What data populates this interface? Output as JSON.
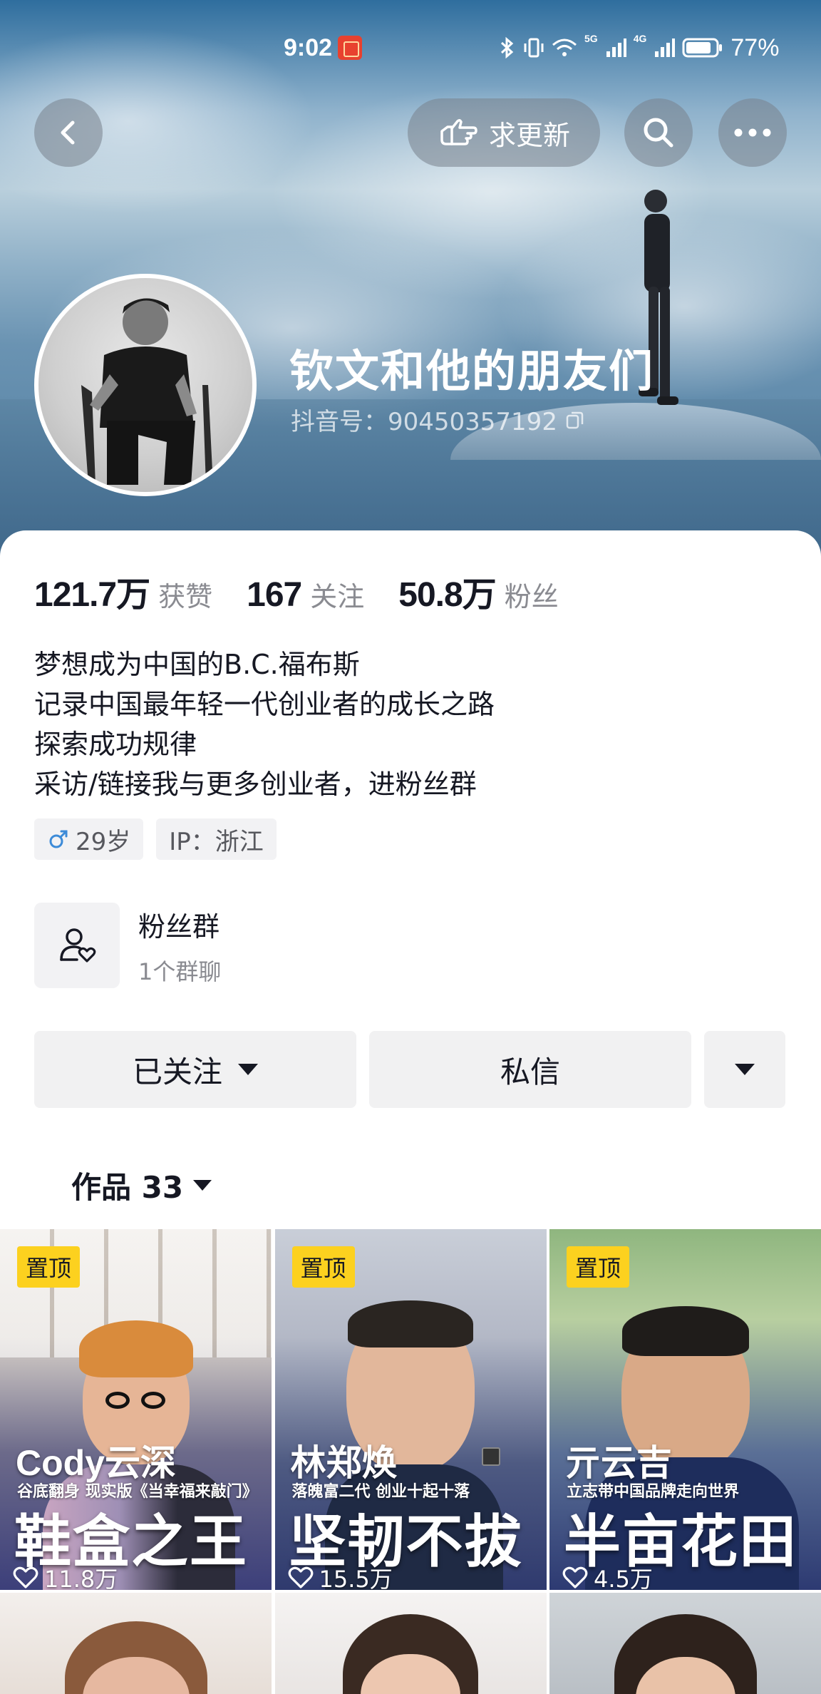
{
  "status_bar": {
    "time": "9:02",
    "battery": "77%",
    "network_labels": [
      "5G",
      "4G"
    ]
  },
  "header": {
    "request_update_label": "求更新",
    "nickname": "钦文和他的朋友们",
    "douyin_id": "抖音号：90450357192"
  },
  "stats": [
    {
      "value": "121.7万",
      "label": "获赞"
    },
    {
      "value": "167",
      "label": "关注"
    },
    {
      "value": "50.8万",
      "label": "粉丝"
    }
  ],
  "bio_lines": [
    "梦想成为中国的B.C.福布斯",
    "记录中国最年轻一代创业者的成长之路",
    "探索成功规律",
    "采访/链接我与更多创业者，进粉丝群"
  ],
  "tags": {
    "age": "29岁",
    "ip": "IP：浙江"
  },
  "fan_group": {
    "title": "粉丝群",
    "subtitle": "1个群聊"
  },
  "actions": {
    "followed_label": "已关注",
    "message_label": "私信"
  },
  "works_tab": {
    "label": "作品 33"
  },
  "videos": [
    {
      "pin": "置顶",
      "name": "Cody云深",
      "subtitle": "谷底翻身 现实版《当幸福来敲门》",
      "title": "鞋盒之王",
      "likes": "11.8万"
    },
    {
      "pin": "置顶",
      "name": "林郑焕",
      "subtitle": "落魄富二代 创业十起十落",
      "title": "坚韧不拔",
      "likes": "15.5万"
    },
    {
      "pin": "置顶",
      "name": "亓云吉",
      "subtitle": "立志带中国品牌走向世界",
      "title": "半亩花田",
      "likes": "4.5万"
    }
  ],
  "colors": {
    "pin_yellow": "#fcd11f",
    "male_blue": "#3d8bd8",
    "text_primary": "#161823",
    "text_secondary": "#8a8b91"
  }
}
